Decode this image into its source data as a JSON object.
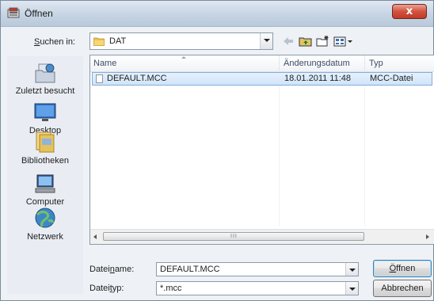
{
  "window": {
    "title": "Öffnen",
    "close_glyph": "x"
  },
  "lookin": {
    "label_pre": "",
    "label_accel": "S",
    "label_post": "uchen in:",
    "value": "DAT"
  },
  "places": [
    {
      "label": "Zuletzt besucht",
      "icon": "recent-places-icon"
    },
    {
      "label": "Desktop",
      "icon": "desktop-icon"
    },
    {
      "label": "Bibliotheken",
      "icon": "libraries-icon"
    },
    {
      "label": "Computer",
      "icon": "computer-icon"
    },
    {
      "label": "Netzwerk",
      "icon": "network-icon"
    }
  ],
  "columns": {
    "name": "Name",
    "date": "Änderungsdatum",
    "type": "Typ"
  },
  "files": [
    {
      "name": "DEFAULT.MCC",
      "date": "18.01.2011 11:48",
      "type": "MCC-Datei"
    }
  ],
  "scrollbar": {
    "grip": "III"
  },
  "filename": {
    "label_pre": "Datei",
    "label_accel": "n",
    "label_post": "ame:",
    "value": "DEFAULT.MCC"
  },
  "filetype": {
    "label_pre": "Datei",
    "label_accel": "t",
    "label_post": "yp:",
    "value": "*.mcc"
  },
  "buttons": {
    "open_pre": "",
    "open_accel": "Ö",
    "open_post": "ffnen",
    "cancel": "Abbrechen"
  },
  "colors": {
    "accent": "#3c7fb1",
    "selection": "#cfe4fa",
    "close": "#c03b27"
  }
}
